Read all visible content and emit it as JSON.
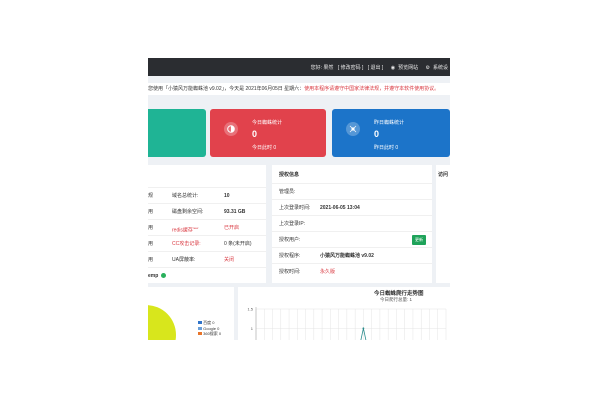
{
  "topbar": {
    "greeting": "您好: 果然",
    "links": [
      "[ 修改密码 ]",
      "[ 退出 ]"
    ],
    "preview": "预览网站",
    "system": "系统设"
  },
  "notice": {
    "text_a": "您使用「小猿风万能蜘蛛池 v9.02」，今天是 2021年06月05日 星期六：",
    "text_b": "使用本程序请遵守中国家法律法规，并遵守本软件使用协议。"
  },
  "cards": {
    "red": {
      "title": "今日蜘蛛统计",
      "value": "0",
      "sub": "今日此时 0"
    },
    "blue": {
      "title": "昨日蜘蛛统计",
      "value": "0",
      "sub": "昨日此时 0"
    }
  },
  "system_panel": {
    "rows": [
      {
        "k1": "规",
        "k2": "域名总统计:",
        "v": "10"
      },
      {
        "k1": "用",
        "k2": "磁盘剩余空间:",
        "v": "93.31 GB"
      },
      {
        "k1": "用",
        "k2": "redis缓存",
        "sup": "new",
        "v": "已开启"
      },
      {
        "k1": "用",
        "k2": "CC攻击记录:",
        "v": "0 条(未开启)"
      },
      {
        "k1": "用",
        "k2": "UA屏蔽率:",
        "v": "关闭"
      }
    ],
    "last": "emp"
  },
  "auth_panel": {
    "title": "授权信息",
    "rows": [
      {
        "k": "管理员:",
        "v": ""
      },
      {
        "k": "上次登录时间:",
        "v": "2021-06-05 13:04"
      },
      {
        "k": "上次登录IP:",
        "v": ""
      },
      {
        "k": "授权用户:",
        "v": "",
        "button": "更新"
      },
      {
        "k": "授权程序:",
        "v": "小猿风万能蜘蛛池 v9.02"
      },
      {
        "k": "授权时间:",
        "v": "永久版"
      }
    ]
  },
  "right_panel": {
    "title": "访问"
  },
  "pie": {
    "legend": [
      "百度 0",
      "Google 0",
      "360搜索 0"
    ],
    "colors": [
      "#2f73c9",
      "#6a9fd8",
      "#e8742a"
    ],
    "fill": "#d8e61c"
  },
  "chart_data": {
    "type": "line",
    "title": "今日蜘蛛爬行走势图",
    "subtitle": "今日爬行总量: 1",
    "y_ticks": [
      "1.5",
      "1",
      "0.5"
    ],
    "ylim": [
      0,
      1.5
    ],
    "series": [
      {
        "values": [
          0,
          0,
          0,
          0,
          0,
          0,
          0,
          0,
          0,
          0,
          0,
          0,
          0,
          1,
          0,
          0,
          0,
          0,
          0,
          0,
          0,
          0,
          0,
          0
        ]
      }
    ],
    "color": "#2a8c8c"
  }
}
